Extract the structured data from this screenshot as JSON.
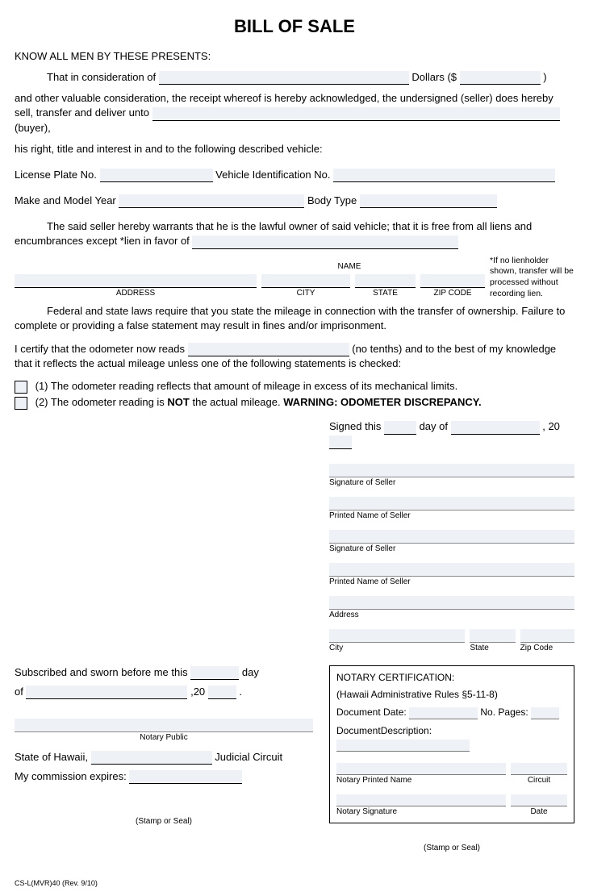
{
  "title": "BILL OF SALE",
  "intro": "KNOW ALL MEN BY THESE PRESENTS:",
  "p1_a": "That in consideration of ",
  "p1_b": " Dollars ($ ",
  "p1_c": " )",
  "p2": "and other valuable consideration, the receipt whereof is hereby acknowledged, the undersigned (seller) does hereby sell, transfer and deliver unto ",
  "p2_b": " (buyer),",
  "p3": "his right, title and interest in and to the following described vehicle:",
  "license": "License Plate No. ",
  "vin": " Vehicle Identification No. ",
  "make": "Make and Model Year ",
  "body": " Body Type ",
  "p4": "The said seller hereby warrants that he is the lawful owner of said vehicle; that it is free from all liens and encumbrances except *lien in favor of ",
  "sub_name": "NAME",
  "sub_address": "ADDRESS",
  "sub_city": "CITY",
  "sub_state": "STATE",
  "sub_zip": "ZIP CODE",
  "lien_note": "*If no lienholder shown, transfer will be processed without recording lien.",
  "p5": "Federal and state laws require that you state the mileage in connection with the transfer of ownership. Failure to complete or providing a false statement may result in fines and/or imprisonment.",
  "p6_a": "I certify that the odometer now reads ",
  "p6_b": " (no tenths) and to the best of my knowledge that it reflects the actual mileage unless one of the following statements is checked:",
  "opt1": "(1)  The odometer reading reflects that amount of mileage in excess of its mechanical limits.",
  "opt2_a": "(2)  The odometer reading is ",
  "opt2_not": "NOT",
  "opt2_b": " the actual mileage. ",
  "opt2_warn": "WARNING: ODOMETER DISCREPANCY.",
  "signed_this": "Signed this ",
  "day_of": " day of ",
  "comma_20": " , 20 ",
  "sig_seller": "Signature of Seller",
  "print_seller": "Printed Name of Seller",
  "address_l": "Address",
  "city_l": "City",
  "state_l": "State",
  "zip_l": "Zip Code",
  "sworn_a": "Subscribed and sworn before me this ",
  "sworn_day": " day",
  "sworn_of": "of ",
  "sworn_20": " ,20 ",
  "sworn_dot": " .",
  "notary_public": "Notary Public",
  "state_hawaii": "State of Hawaii, ",
  "judicial": " Judicial Circuit",
  "commission": "My commission expires: ",
  "stamp": "(Stamp or Seal)",
  "box_title": "NOTARY CERTIFICATION:",
  "box_rules": "(Hawaii Administrative Rules §5-11-8)",
  "box_docdate": "Document Date: ",
  "box_pages": " No. Pages: ",
  "box_desc": "DocumentDescription:",
  "box_printed": "Notary Printed Name",
  "box_circuit": "Circuit",
  "box_sig": "Notary Signature",
  "box_date": "Date",
  "footer": "CS-L(MVR)40 (Rev. 9/10)"
}
